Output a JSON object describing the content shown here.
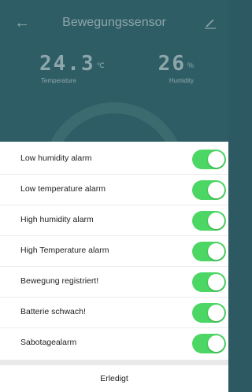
{
  "header": {
    "title": "Bewegungssensor",
    "temperature": {
      "value": "24.3",
      "unit": "℃",
      "label": "Temperature"
    },
    "humidity": {
      "value": "26",
      "unit": "%",
      "label": "Humidity"
    }
  },
  "alarms": [
    {
      "label": "Low humidity alarm",
      "enabled": true
    },
    {
      "label": "Low temperature alarm",
      "enabled": true
    },
    {
      "label": "High humidity alarm",
      "enabled": true
    },
    {
      "label": "High Temperature alarm",
      "enabled": true
    },
    {
      "label": "Bewegung registriert!",
      "enabled": true
    },
    {
      "label": "Batterie schwach!",
      "enabled": true
    },
    {
      "label": "Sabotagealarm",
      "enabled": true
    }
  ],
  "footer": {
    "done_label": "Erledigt"
  },
  "colors": {
    "header_bg": "#2f5d65",
    "toggle_on": "#4cd764"
  }
}
